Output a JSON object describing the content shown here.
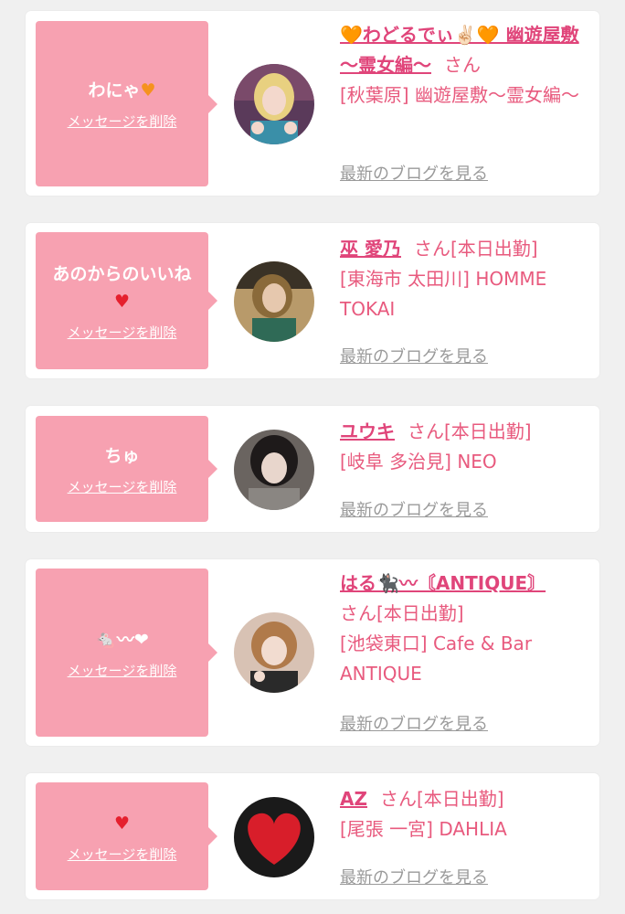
{
  "colors": {
    "bubble": "#f7a1b1",
    "name": "#e0457a",
    "text_pink": "#e85a7e",
    "link_gray": "#9a9a9a",
    "background": "#f0f0f0"
  },
  "items": [
    {
      "message": "わにゃ",
      "message_icon": "orange-heart-icon",
      "delete_label": "メッセージを削除",
      "name": "🧡わどるでぃ✌🏻🧡 幽遊屋敷 〜霊女編〜",
      "san": "さん",
      "status": "",
      "shop": "[秋葉原] 幽遊屋敷〜霊女編〜",
      "blog_label": "最新のブログを見る"
    },
    {
      "message": "あのからのいいね",
      "message_icon": "red-heart-icon",
      "delete_label": "メッセージを削除",
      "name": "巫 愛乃",
      "san": "さん",
      "status": "[本日出勤]",
      "shop": "[東海市 太田川] HOMME TOKAI",
      "blog_label": "最新のブログを見る"
    },
    {
      "message": "ちゅ",
      "message_icon": "",
      "delete_label": "メッセージを削除",
      "name": "ユウキ",
      "san": "さん",
      "status": "[本日出勤]",
      "shop": "[岐阜 多治見] NEO",
      "blog_label": "最新のブログを見る"
    },
    {
      "message": "🐁〰❤",
      "message_icon": "",
      "delete_label": "メッセージを削除",
      "name": "はる🐈‍⬛〰〘ANTIQUE〙",
      "san": "さん",
      "status": "[本日出勤]",
      "shop": "[池袋東口] Cafe & Bar ANTIQUE",
      "blog_label": "最新のブログを見る"
    },
    {
      "message": "",
      "message_icon": "red-heart-icon",
      "delete_label": "メッセージを削除",
      "name": "AZ",
      "san": "さん",
      "status": "[本日出勤]",
      "shop": "[尾張 一宮] DAHLIA",
      "blog_label": "最新のブログを見る"
    }
  ]
}
